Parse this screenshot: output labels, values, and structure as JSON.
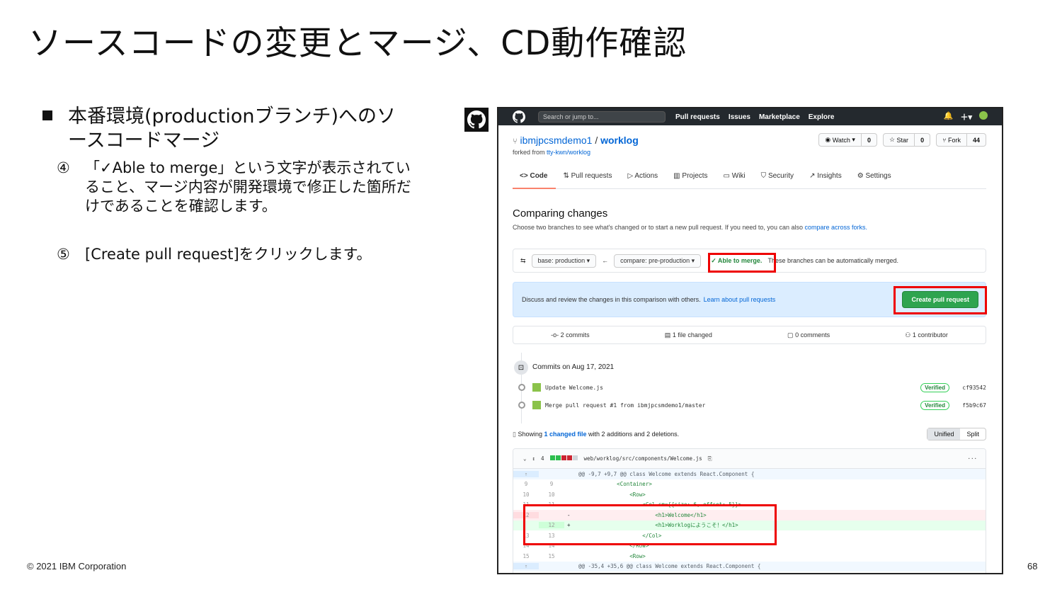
{
  "slide": {
    "title": "ソースコードの変更とマージ、CD動作確認",
    "bullet": "本番環境(productionブランチ)へのソースコードマージ",
    "steps": [
      {
        "num": "④",
        "text": "「✓Able to merge」という文字が表示されていること、マージ内容が開発環境で修正した箇所だけであることを確認します。"
      },
      {
        "num": "⑤",
        "text": "[Create pull request]をクリックします。"
      }
    ],
    "copyright": "© 2021 IBM Corporation",
    "page": "68"
  },
  "github": {
    "topbar": {
      "search": "Search or jump to...",
      "search_key": "/",
      "nav": [
        "Pull requests",
        "Issues",
        "Marketplace",
        "Explore"
      ]
    },
    "repo": {
      "owner": "ibmjpcsmdemo1",
      "sep": "/",
      "name": "worklog",
      "forked_prefix": "forked from",
      "forked_from": "tty-kwn/worklog"
    },
    "buttons": {
      "watch": "Watch",
      "watch_count": "0",
      "star": "Star",
      "star_count": "0",
      "fork": "Fork",
      "fork_count": "44"
    },
    "tabs": [
      "Code",
      "Pull requests",
      "Actions",
      "Projects",
      "Wiki",
      "Security",
      "Insights",
      "Settings"
    ],
    "compare": {
      "title": "Comparing changes",
      "subtitle": "Choose two branches to see what's changed or to start a new pull request. If you need to, you can also",
      "subtitle_link": "compare across forks.",
      "base": "base: production ▾",
      "arrow": "←",
      "head": "compare: pre-production ▾",
      "able": "✓ Able to merge.",
      "able_rest": "These branches can be automatically merged."
    },
    "discuss": {
      "text": "Discuss and review the changes in this comparison with others.",
      "link": "Learn about pull requests",
      "button": "Create pull request"
    },
    "stats": [
      "2 commits",
      "1 file changed",
      "0 comments",
      "1 contributor"
    ],
    "commits": {
      "heading": "Commits on Aug 17, 2021",
      "items": [
        {
          "msg": "Update Welcome.js",
          "badge": "Verified",
          "sha": "cf93542"
        },
        {
          "msg": "Merge pull request #1 from ibmjpcsmdemo1/master",
          "badge": "Verified",
          "sha": "f5b9c67"
        }
      ]
    },
    "showing": {
      "prefix": "Showing",
      "link": "1 changed file",
      "suffix": "with 2 additions and 2 deletions.",
      "unified": "Unified",
      "split": "Split"
    },
    "file": {
      "count": "4",
      "path": "web/worklog/src/components/Welcome.js"
    },
    "diff": [
      {
        "type": "hunk",
        "l": "",
        "r": "",
        "s": "",
        "code": "@@ -9,7 +9,7 @@ class Welcome extends React.Component {"
      },
      {
        "type": "ctx",
        "l": "9",
        "r": "9",
        "s": "",
        "code": "            <Container>"
      },
      {
        "type": "ctx",
        "l": "10",
        "r": "10",
        "s": "",
        "code": "                <Row>"
      },
      {
        "type": "ctx",
        "l": "11",
        "r": "11",
        "s": "",
        "code": "                    <Col sm={{size: 6, offset: 5}}>"
      },
      {
        "type": "del",
        "l": "12",
        "r": "",
        "s": "-",
        "code": "                        <h1>Welcome</h1>"
      },
      {
        "type": "add",
        "l": "",
        "r": "12",
        "s": "+",
        "code": "                        <h1>Worklogにようこそ！</h1>"
      },
      {
        "type": "ctx",
        "l": "13",
        "r": "13",
        "s": "",
        "code": "                    </Col>"
      },
      {
        "type": "ctx",
        "l": "14",
        "r": "14",
        "s": "",
        "code": "                </Row>"
      },
      {
        "type": "ctx",
        "l": "15",
        "r": "15",
        "s": "",
        "code": "                <Row>"
      },
      {
        "type": "hunk",
        "l": "",
        "r": "",
        "s": "",
        "code": "@@ -35,4 +35,6 @@ class Welcome extends React.Component {"
      }
    ],
    "colors": {
      "topbar": "#24292e",
      "green": "#2ea44f",
      "link": "#0366d6",
      "highlight": "#ee0000"
    }
  }
}
